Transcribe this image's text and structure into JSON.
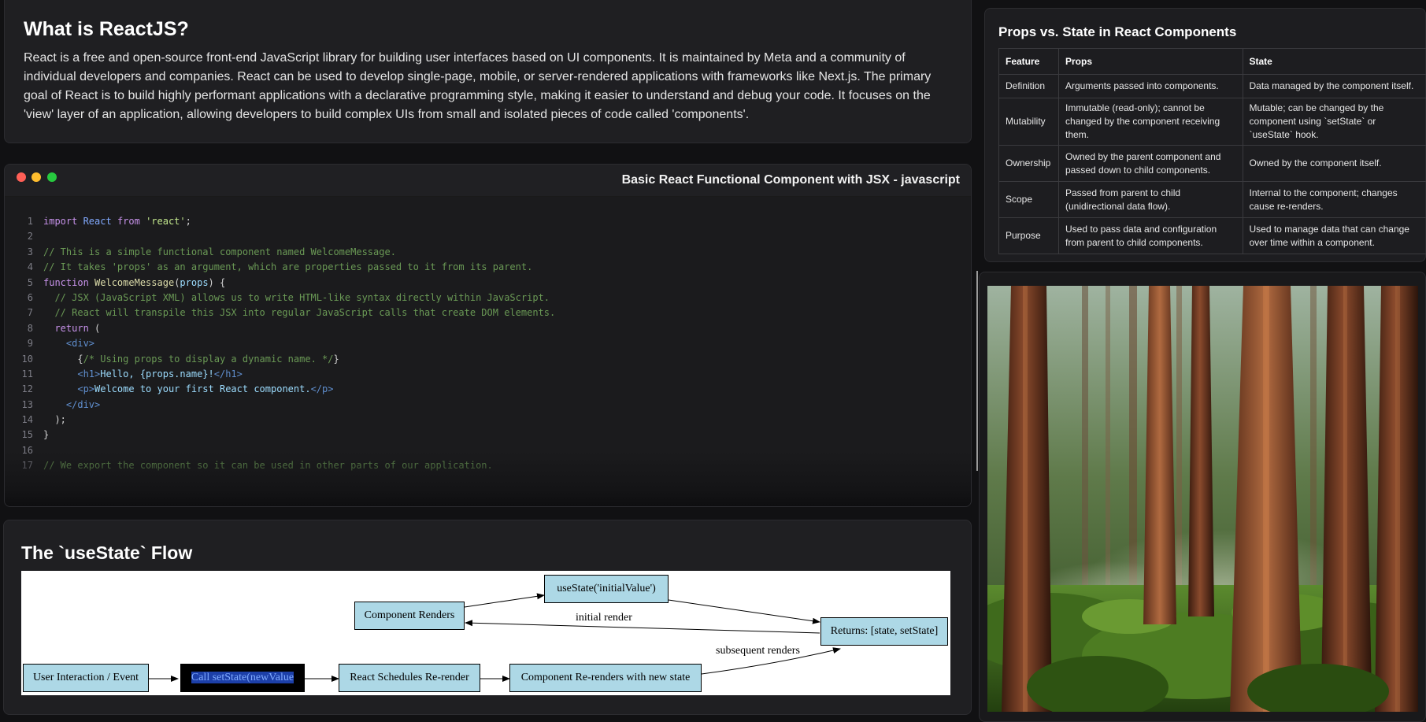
{
  "intro": {
    "title": "What is ReactJS?",
    "body": "React is a free and open-source front-end JavaScript library for building user interfaces based on UI components. It is maintained by Meta and a community of individual developers and companies. React can be used to develop single-page, mobile, or server-rendered applications with frameworks like Next.js. The primary goal of React is to build highly performant applications with a declarative programming style, making it easier to understand and debug your code. It focuses on the 'view' layer of an application, allowing developers to build complex UIs from small and isolated pieces of code called 'components'."
  },
  "code": {
    "title": "Basic React Functional Component with JSX - javascript",
    "window_buttons": [
      "close",
      "minimize",
      "maximize"
    ],
    "lines": [
      {
        "n": "1",
        "parts": [
          [
            "kw",
            "import "
          ],
          [
            "id",
            "React "
          ],
          [
            "kw",
            "from "
          ],
          [
            "str",
            "'react'"
          ],
          [
            "txt",
            ";"
          ]
        ]
      },
      {
        "n": "2",
        "parts": []
      },
      {
        "n": "3",
        "parts": [
          [
            "cm",
            "// This is a simple functional component named WelcomeMessage."
          ]
        ]
      },
      {
        "n": "4",
        "parts": [
          [
            "cm",
            "// It takes 'props' as an argument, which are properties passed to it from its parent."
          ]
        ]
      },
      {
        "n": "5",
        "parts": [
          [
            "kw",
            "function "
          ],
          [
            "fn",
            "WelcomeMessage"
          ],
          [
            "txt",
            "("
          ],
          [
            "tx",
            "props"
          ],
          [
            "txt",
            ") {"
          ]
        ]
      },
      {
        "n": "6",
        "parts": [
          [
            "cm",
            "  // JSX (JavaScript XML) allows us to write HTML-like syntax directly within JavaScript."
          ]
        ]
      },
      {
        "n": "7",
        "parts": [
          [
            "cm",
            "  // React will transpile this JSX into regular JavaScript calls that create DOM elements."
          ]
        ]
      },
      {
        "n": "8",
        "parts": [
          [
            "kw",
            "  return "
          ],
          [
            "txt",
            "("
          ]
        ]
      },
      {
        "n": "9",
        "parts": [
          [
            "tag",
            "    <div>"
          ]
        ]
      },
      {
        "n": "10",
        "parts": [
          [
            "txt",
            "      {"
          ],
          [
            "cm",
            "/* Using props to display a dynamic name. */"
          ],
          [
            "txt",
            "}"
          ]
        ]
      },
      {
        "n": "11",
        "parts": [
          [
            "tag",
            "      <h1>"
          ],
          [
            "tx",
            "Hello, {props.name}!"
          ],
          [
            "tag",
            "</h1>"
          ]
        ]
      },
      {
        "n": "12",
        "parts": [
          [
            "tag",
            "      <p>"
          ],
          [
            "tx",
            "Welcome to your first React component."
          ],
          [
            "tag",
            "</p>"
          ]
        ]
      },
      {
        "n": "13",
        "parts": [
          [
            "tag",
            "    </div>"
          ]
        ]
      },
      {
        "n": "14",
        "parts": [
          [
            "txt",
            "  );"
          ]
        ]
      },
      {
        "n": "15",
        "parts": [
          [
            "txt",
            "}"
          ]
        ]
      },
      {
        "n": "16",
        "parts": []
      },
      {
        "n": "17",
        "parts": [
          [
            "cm",
            "// We export the component so it can be used in other parts of our application."
          ]
        ]
      }
    ]
  },
  "flow": {
    "title": "The `useState` Flow",
    "nodes": {
      "user_event": "User Interaction / Event",
      "call_setstate": "Call setState(newValue",
      "schedules": "React Schedules Re-render",
      "rerenders": "Component Re-renders with new state",
      "component_renders": "Component Renders",
      "use_state": "useState('initialValue')",
      "returns": "Returns: [state, setState]"
    },
    "edge_labels": {
      "initial": "initial render",
      "subsequent": "subsequent renders"
    }
  },
  "table": {
    "title": "Props vs. State in React Components",
    "headers": [
      "Feature",
      "Props",
      "State"
    ],
    "rows": [
      [
        "Definition",
        "Arguments passed into components.",
        "Data managed by the component itself."
      ],
      [
        "Mutability",
        "Immutable (read-only); cannot be changed by the component receiving them.",
        "Mutable; can be changed by the component using `setState` or `useState` hook."
      ],
      [
        "Ownership",
        "Owned by the parent component and passed down to child components.",
        "Owned by the component itself."
      ],
      [
        "Scope",
        "Passed from parent to child (unidirectional data flow).",
        "Internal to the component; changes cause re-renders."
      ],
      [
        "Purpose",
        "Used to pass data and configuration from parent to child components.",
        "Used to manage data that can change over time within a component."
      ]
    ]
  },
  "image": {
    "subject": "sunlit-redwood-forest"
  }
}
